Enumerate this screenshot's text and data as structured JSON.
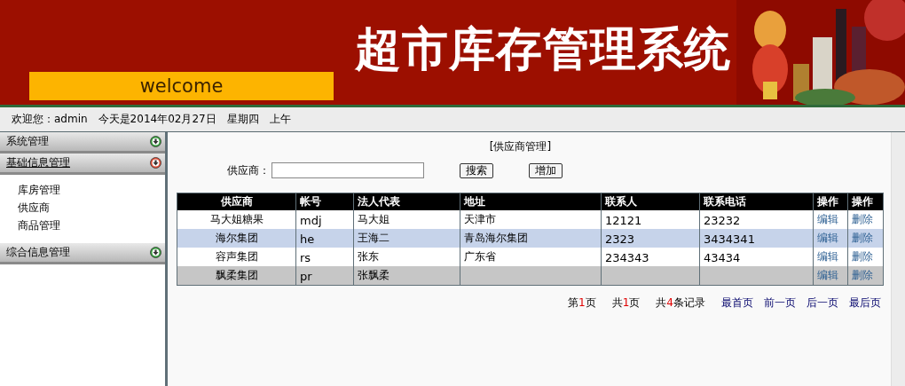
{
  "banner": {
    "welcome": "welcome",
    "title": "超市库存管理系统"
  },
  "info_bar": [
    "欢迎您：admin",
    "今天是2014年02月27日",
    "星期四",
    "上午"
  ],
  "sidebar": [
    {
      "label": "系统管理",
      "expanded": false
    },
    {
      "label": "基础信息管理",
      "expanded": true,
      "children": [
        {
          "label": "库房管理"
        },
        {
          "label": "供应商"
        },
        {
          "label": "商品管理"
        }
      ]
    },
    {
      "label": "综合信息管理",
      "expanded": false
    }
  ],
  "page_title": "[供应商管理]",
  "search": {
    "label": "供应商：",
    "buttons": [
      "搜索",
      "增加"
    ]
  },
  "table": {
    "columns": [
      "供应商",
      "帐号",
      "法人代表",
      "地址",
      "联系人",
      "联系电话",
      "操作",
      "操作"
    ],
    "rows": [
      {
        "kind": "plain",
        "cells": [
          "马大姐糖果",
          "mdj",
          "马大姐",
          "天津市",
          "12121",
          "23232"
        ],
        "actions": [
          "编辑",
          "删除"
        ]
      },
      {
        "kind": "hover",
        "cells": [
          "海尔集团",
          "he",
          "王海二",
          "青岛海尔集团",
          "2323",
          "3434341"
        ],
        "actions": [
          "编辑",
          "删除"
        ]
      },
      {
        "kind": "plain",
        "cells": [
          "容声集团",
          "rs",
          "张东",
          "广东省",
          "234343",
          "43434"
        ],
        "actions": [
          "编辑",
          "删除"
        ]
      },
      {
        "kind": "shaded",
        "cells": [
          "飘柔集团",
          "pr",
          "张飘柔",
          "",
          "",
          ""
        ],
        "actions": [
          "编辑",
          "删除"
        ]
      }
    ]
  },
  "pager": {
    "counts": [
      {
        "before": "第",
        "number": "1",
        "after": "页"
      },
      {
        "before": "共",
        "number": "1",
        "after": "页"
      },
      {
        "before": "共",
        "number": "4",
        "after": "条记录"
      }
    ],
    "links": [
      "最首页",
      "前一页",
      "后一页",
      "最后页"
    ]
  }
}
